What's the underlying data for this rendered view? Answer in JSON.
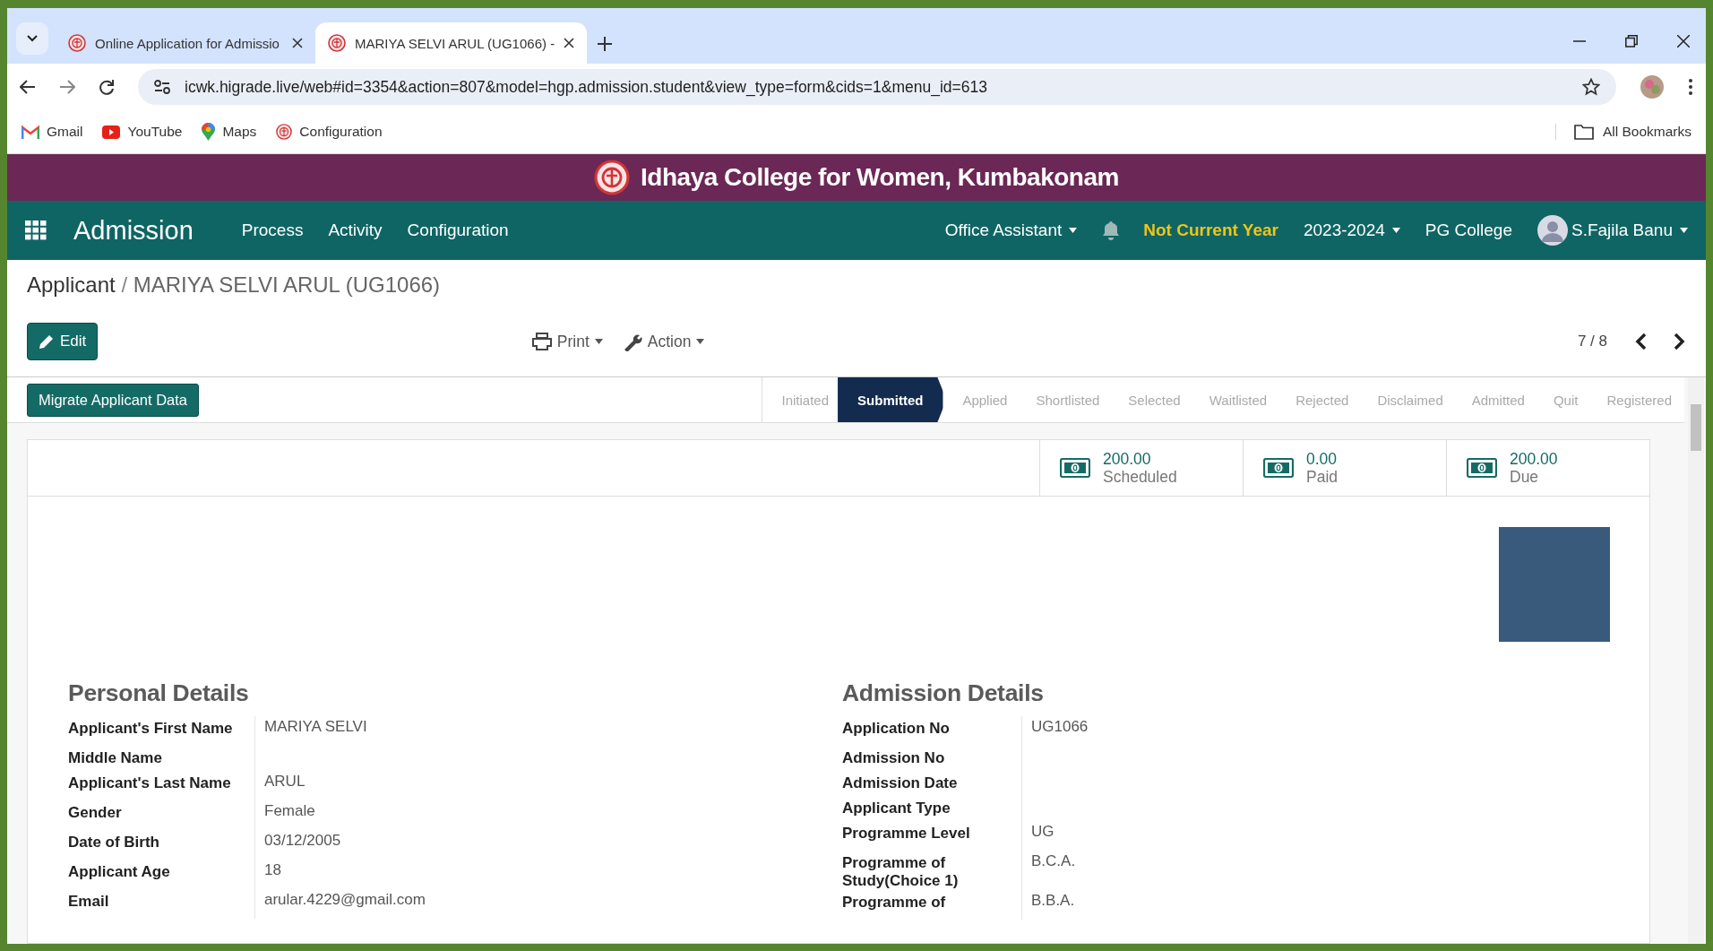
{
  "browser": {
    "tabs": [
      {
        "title": "Online Application for Admissio",
        "selected": false
      },
      {
        "title": "MARIYA SELVI ARUL (UG1066) -",
        "selected": true
      }
    ],
    "url": "icwk.higrade.live/web#id=3354&action=807&model=hgp.admission.student&view_type=form&cids=1&menu_id=613",
    "bookmarks": [
      "Gmail",
      "YouTube",
      "Maps",
      "Configuration"
    ],
    "all_bookmarks": "All Bookmarks"
  },
  "banner": {
    "title": "Idhaya College for Women, Kumbakonam"
  },
  "navbar": {
    "app": "Admission",
    "menu": [
      "Process",
      "Activity",
      "Configuration"
    ],
    "role": "Office Assistant",
    "year_warning": "Not Current Year",
    "year": "2023-2024",
    "company": "PG College",
    "user": "S.Fajila Banu"
  },
  "breadcrumb": {
    "parent": "Applicant",
    "separator": "/",
    "current": "MARIYA SELVI ARUL (UG1066)"
  },
  "toolbar": {
    "edit": "Edit",
    "print": "Print",
    "action": "Action",
    "pager": "7 / 8"
  },
  "migrate_button": "Migrate Applicant Data",
  "stages": [
    {
      "label": "Initiated",
      "selected": false
    },
    {
      "label": "Submitted",
      "selected": true
    },
    {
      "label": "Applied",
      "selected": false
    },
    {
      "label": "Shortlisted",
      "selected": false
    },
    {
      "label": "Selected",
      "selected": false
    },
    {
      "label": "Waitlisted",
      "selected": false
    },
    {
      "label": "Rejected",
      "selected": false
    },
    {
      "label": "Disclaimed",
      "selected": false
    },
    {
      "label": "Admitted",
      "selected": false
    },
    {
      "label": "Quit",
      "selected": false
    },
    {
      "label": "Registered",
      "selected": false
    }
  ],
  "stat_buttons": [
    {
      "value": "200.00",
      "label": "Scheduled"
    },
    {
      "value": "0.00",
      "label": "Paid"
    },
    {
      "value": "200.00",
      "label": "Due"
    }
  ],
  "personal_details": {
    "title": "Personal Details",
    "fields": [
      {
        "label": "Applicant's First Name",
        "value": "MARIYA SELVI"
      },
      {
        "label": "Middle Name"
      },
      {
        "label": "Applicant's Last Name",
        "value": "ARUL"
      },
      {
        "label": "Gender",
        "value": "Female"
      },
      {
        "label": "Date of Birth",
        "value": "03/12/2005"
      },
      {
        "label": "Applicant Age",
        "value": "18"
      },
      {
        "label": "Email",
        "value": "arular.4229@gmail.com"
      }
    ]
  },
  "admission_details": {
    "title": "Admission Details",
    "fields": [
      {
        "label": "Application No",
        "value": "UG1066"
      },
      {
        "label": "Admission No"
      },
      {
        "label": "Admission Date"
      },
      {
        "label": "Applicant Type"
      },
      {
        "label": "Programme Level",
        "value": "UG"
      },
      {
        "label": "Programme of Study(Choice 1)",
        "value": "B.C.A."
      },
      {
        "label": "Programme of",
        "value": "B.B.A."
      }
    ]
  }
}
